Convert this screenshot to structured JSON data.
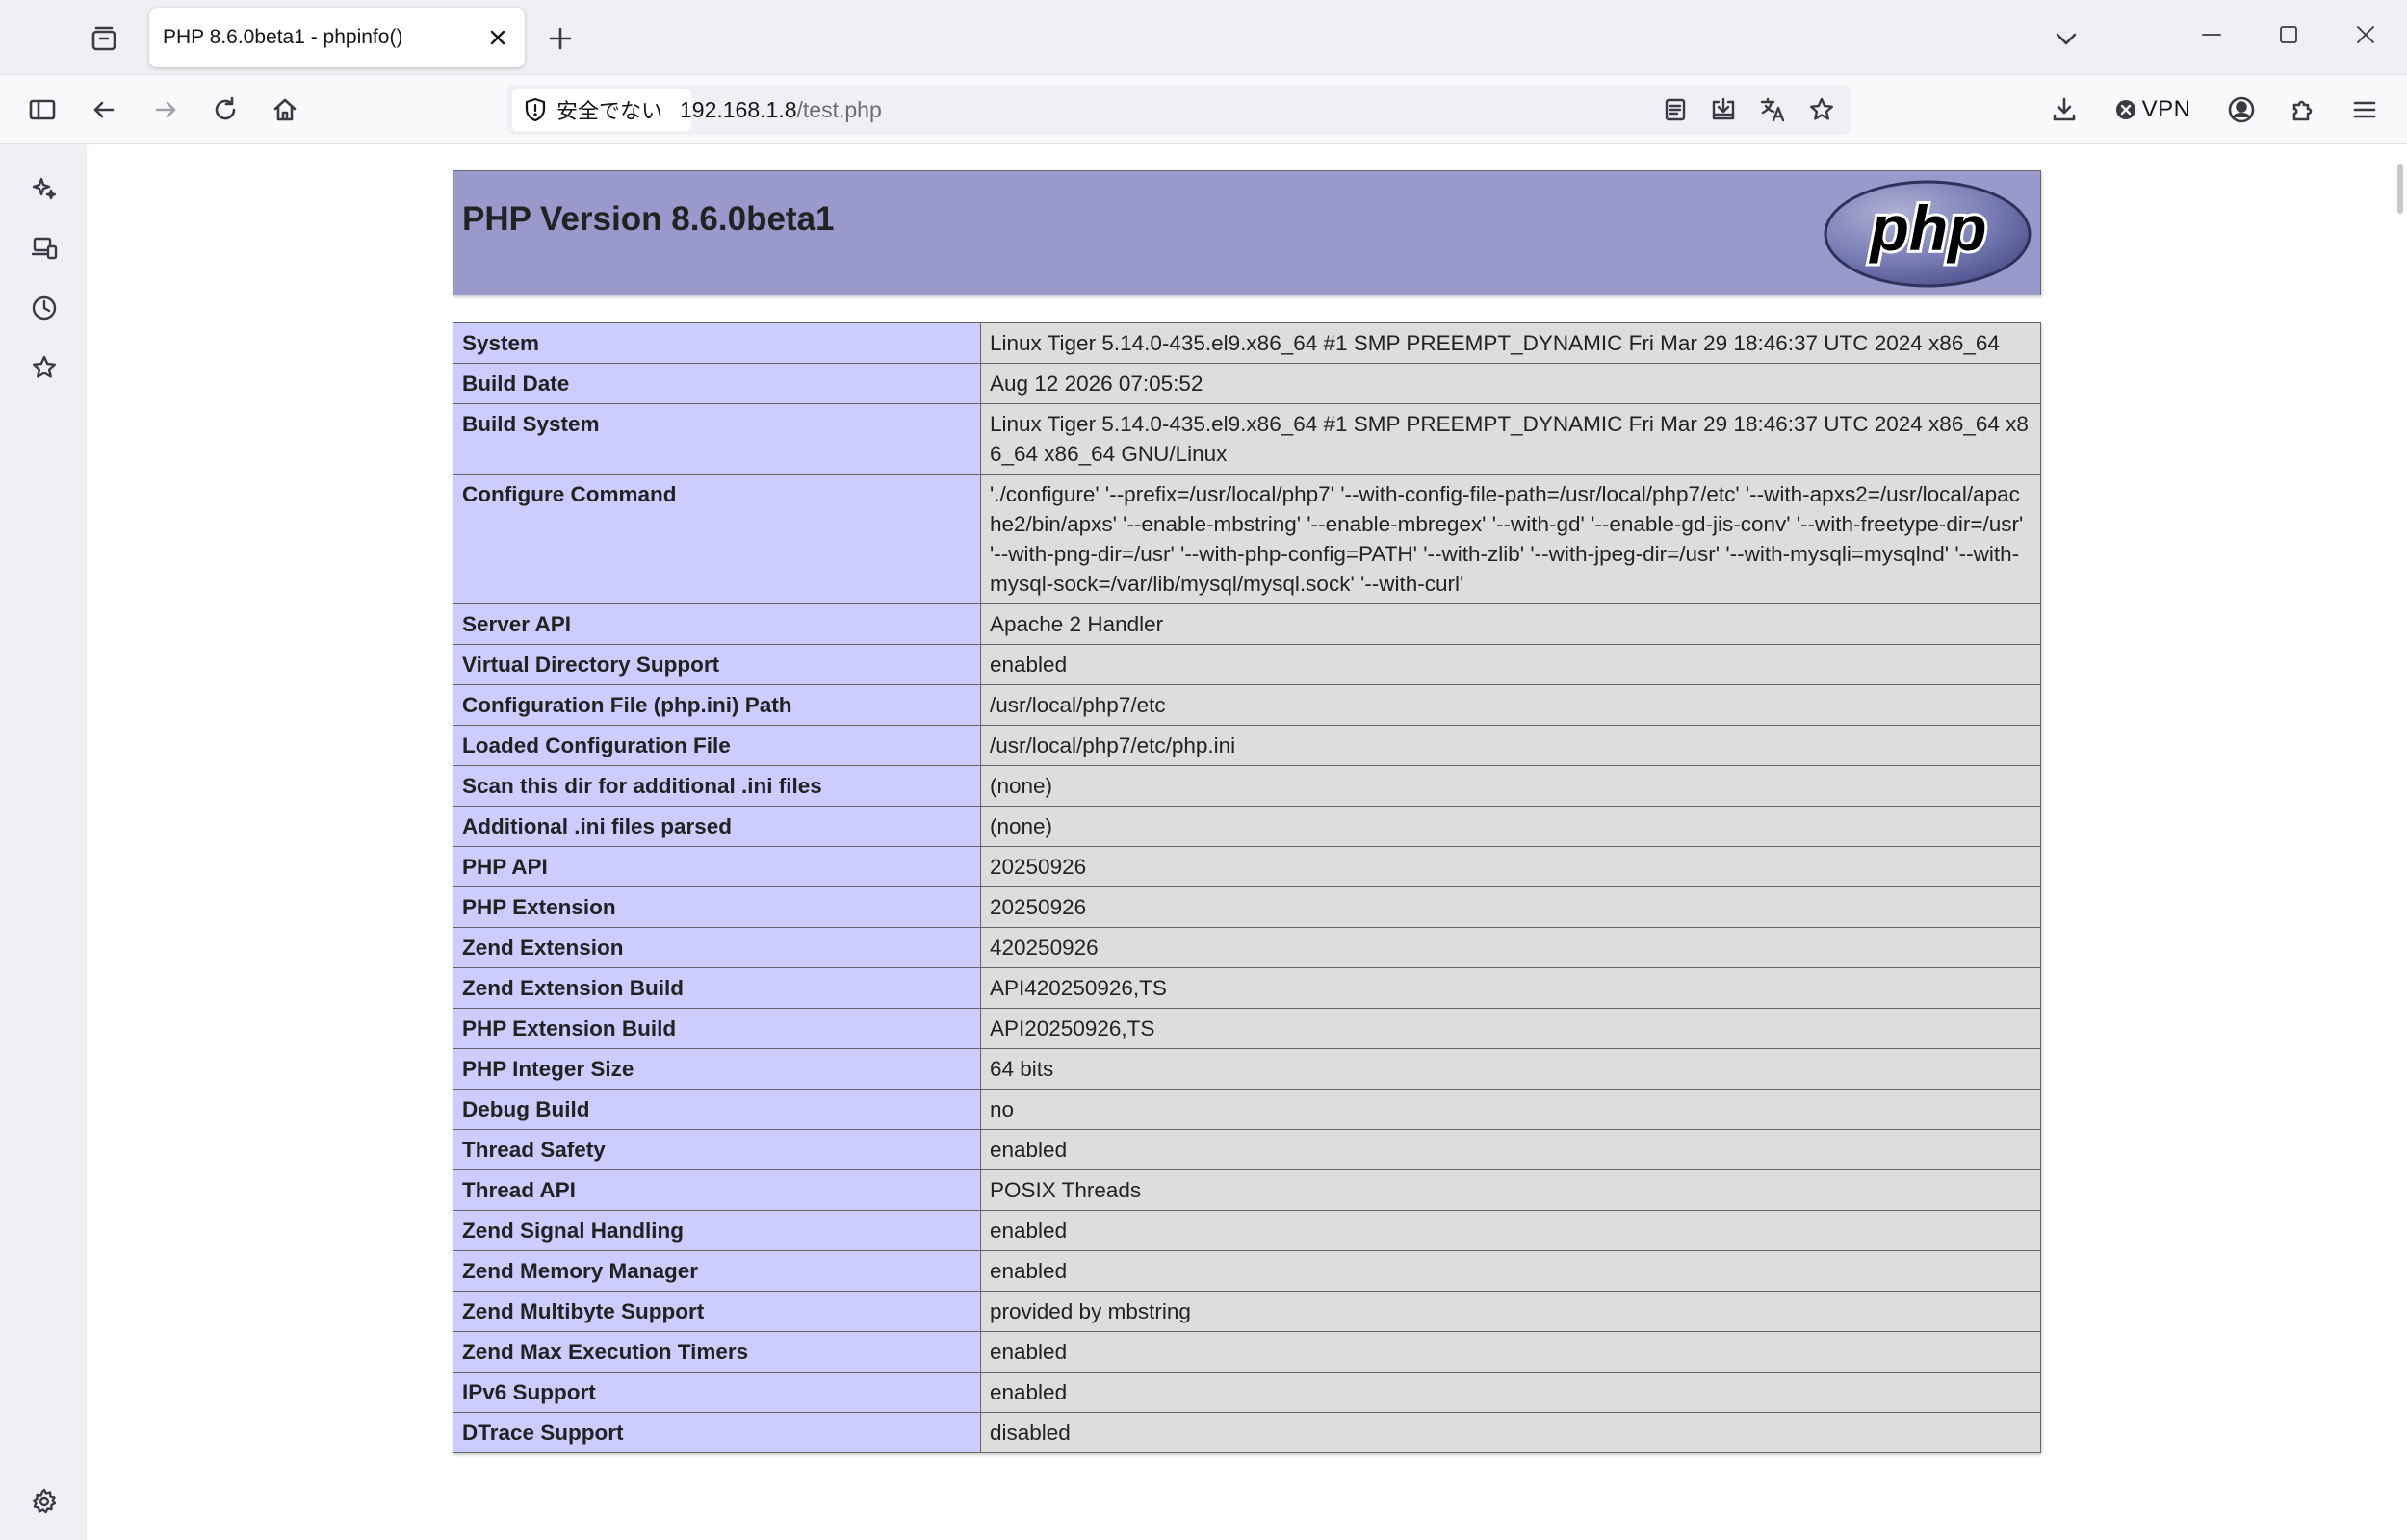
{
  "browser": {
    "tab": {
      "title": "PHP 8.6.0beta1 - phpinfo()"
    },
    "urlbar": {
      "security_label": "安全でない",
      "host": "192.168.1.8",
      "path": "/test.php"
    },
    "vpn_label": "VPN",
    "icons": {
      "tab_view": "tab-overview-icon",
      "new_tab": "plus-icon",
      "list_tabs": "chevron-down-icon",
      "sidebar_toggle": "sidebar-icon",
      "back": "back-arrow-icon",
      "forward": "forward-arrow-icon",
      "reload": "reload-icon",
      "home": "home-icon",
      "reader": "reader-view-icon",
      "save_page": "save-to-pocket-icon",
      "translate": "translate-icon",
      "bookmark": "star-icon",
      "downloads": "download-icon",
      "account": "account-icon",
      "extensions": "puzzle-icon",
      "menu": "hamburger-menu-icon"
    }
  },
  "sidebar": {
    "items": [
      "ai-chatbot-icon",
      "synced-tabs-icon",
      "history-icon",
      "bookmarks-icon"
    ],
    "bottom": "settings-icon"
  },
  "phpinfo": {
    "title": "PHP Version 8.6.0beta1",
    "logo_text": "php",
    "colors": {
      "header": "#9999cc",
      "label_cell": "#ccccff",
      "value_cell": "#dddddd"
    },
    "rows": [
      {
        "label": "System",
        "value": "Linux Tiger 5.14.0-435.el9.x86_64 #1 SMP PREEMPT_DYNAMIC Fri Mar 29 18:46:37 UTC 2024 x86_64"
      },
      {
        "label": "Build Date",
        "value": "Aug 12 2026 07:05:52"
      },
      {
        "label": "Build System",
        "value": "Linux Tiger 5.14.0-435.el9.x86_64 #1 SMP PREEMPT_DYNAMIC Fri Mar 29 18:46:37 UTC 2024 x86_64 x86_64 x86_64 GNU/Linux"
      },
      {
        "label": "Configure Command",
        "value": "'./configure' '--prefix=/usr/local/php7' '--with-config-file-path=/usr/local/php7/etc' '--with-apxs2=/usr/local/apache2/bin/apxs' '--enable-mbstring' '--enable-mbregex' '--with-gd' '--enable-gd-jis-conv' '--with-freetype-dir=/usr' '--with-png-dir=/usr' '--with-php-config=PATH' '--with-zlib' '--with-jpeg-dir=/usr' '--with-mysqli=mysqlnd' '--with-mysql-sock=/var/lib/mysql/mysql.sock' '--with-curl'"
      },
      {
        "label": "Server API",
        "value": "Apache 2 Handler"
      },
      {
        "label": "Virtual Directory Support",
        "value": "enabled"
      },
      {
        "label": "Configuration File (php.ini) Path",
        "value": "/usr/local/php7/etc"
      },
      {
        "label": "Loaded Configuration File",
        "value": "/usr/local/php7/etc/php.ini"
      },
      {
        "label": "Scan this dir for additional .ini files",
        "value": "(none)"
      },
      {
        "label": "Additional .ini files parsed",
        "value": "(none)"
      },
      {
        "label": "PHP API",
        "value": "20250926"
      },
      {
        "label": "PHP Extension",
        "value": "20250926"
      },
      {
        "label": "Zend Extension",
        "value": "420250926"
      },
      {
        "label": "Zend Extension Build",
        "value": "API420250926,TS"
      },
      {
        "label": "PHP Extension Build",
        "value": "API20250926,TS"
      },
      {
        "label": "PHP Integer Size",
        "value": "64 bits"
      },
      {
        "label": "Debug Build",
        "value": "no"
      },
      {
        "label": "Thread Safety",
        "value": "enabled"
      },
      {
        "label": "Thread API",
        "value": "POSIX Threads"
      },
      {
        "label": "Zend Signal Handling",
        "value": "enabled"
      },
      {
        "label": "Zend Memory Manager",
        "value": "enabled"
      },
      {
        "label": "Zend Multibyte Support",
        "value": "provided by mbstring"
      },
      {
        "label": "Zend Max Execution Timers",
        "value": "enabled"
      },
      {
        "label": "IPv6 Support",
        "value": "enabled"
      },
      {
        "label": "DTrace Support",
        "value": "disabled"
      }
    ]
  }
}
